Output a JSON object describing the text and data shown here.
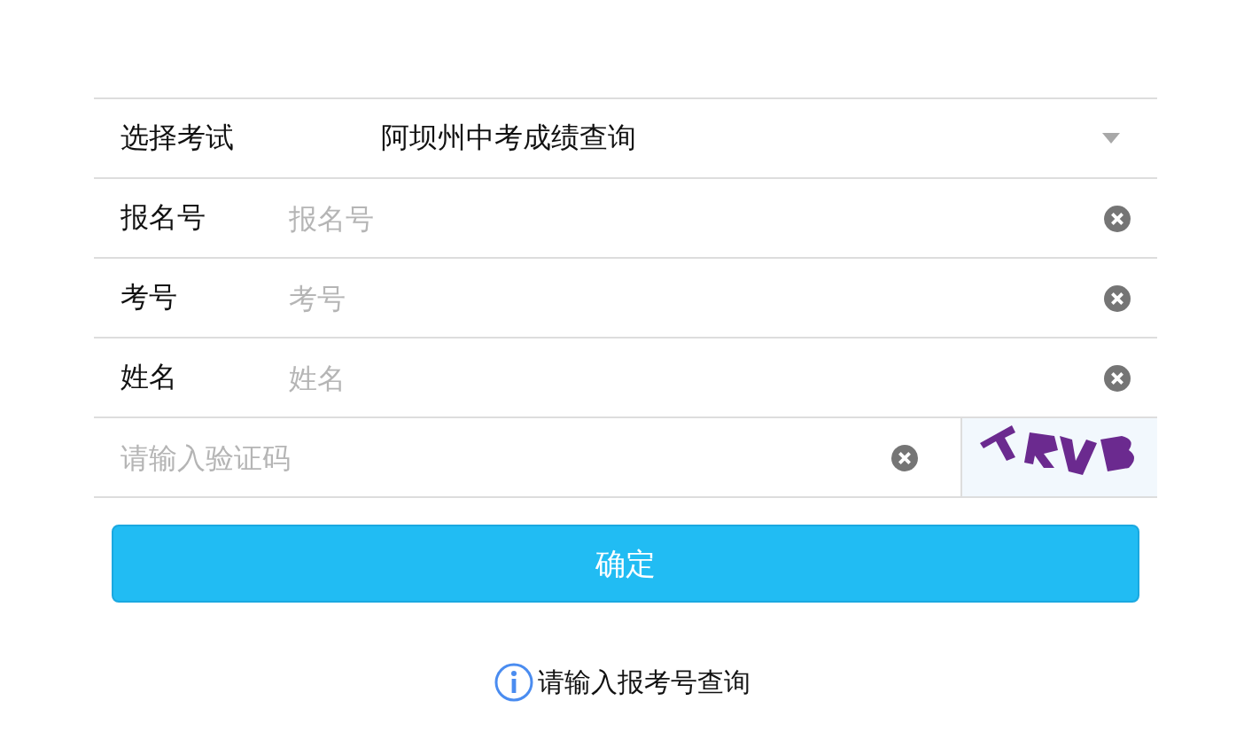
{
  "exam_select": {
    "label": "选择考试",
    "value": "阿坝州中考成绩查询"
  },
  "fields": [
    {
      "label": "报名号",
      "placeholder": "报名号"
    },
    {
      "label": "考号",
      "placeholder": "考号"
    },
    {
      "label": "姓名",
      "placeholder": "姓名"
    }
  ],
  "captcha": {
    "placeholder": "请输入验证码"
  },
  "submit_button": "确定",
  "hint": "请输入报考号查询"
}
